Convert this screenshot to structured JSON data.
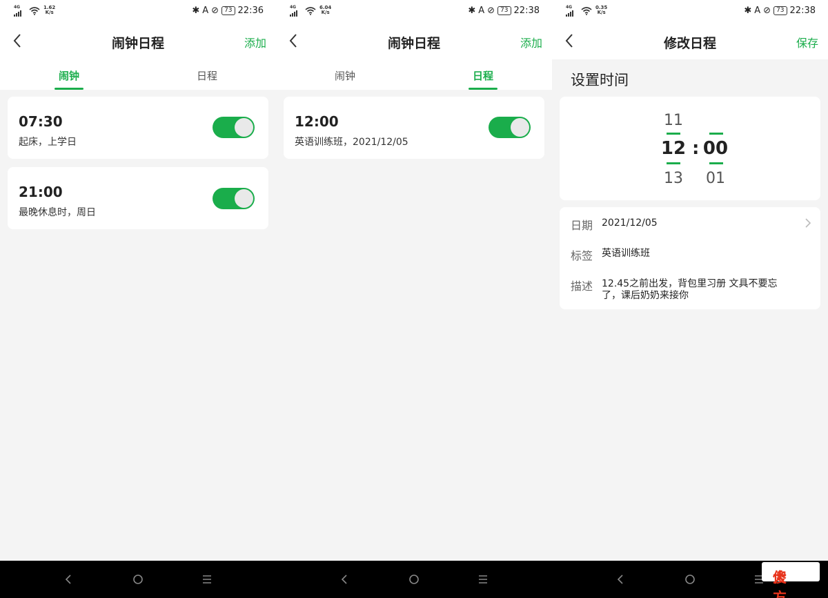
{
  "colors": {
    "accent": "#1aad4b",
    "background": "#f4f4f4",
    "card": "#ffffff"
  },
  "screen1": {
    "status": {
      "net": "4G",
      "speed_top": "1.62",
      "speed_unit": "K/s",
      "battery": "73",
      "clock": "22:36"
    },
    "header": {
      "title": "闹钟日程",
      "action": "添加"
    },
    "tabs": [
      {
        "label": "闹钟",
        "active": true
      },
      {
        "label": "日程",
        "active": false
      }
    ],
    "items": [
      {
        "time": "07:30",
        "desc": "起床，上学日",
        "enabled": true
      },
      {
        "time": "21:00",
        "desc": "最晚休息时，周日",
        "enabled": true
      }
    ]
  },
  "screen2": {
    "status": {
      "net": "4G",
      "speed_top": "6.04",
      "speed_unit": "K/s",
      "battery": "73",
      "clock": "22:38"
    },
    "header": {
      "title": "闹钟日程",
      "action": "添加"
    },
    "tabs": [
      {
        "label": "闹钟",
        "active": false
      },
      {
        "label": "日程",
        "active": true
      }
    ],
    "items": [
      {
        "time": "12:00",
        "desc": "英语训练班，2021/12/05",
        "enabled": true
      }
    ]
  },
  "screen3": {
    "status": {
      "net": "4G",
      "speed_top": "0.35",
      "speed_unit": "K/s",
      "battery": "73",
      "clock": "22:38"
    },
    "header": {
      "title": "修改日程",
      "action": "保存"
    },
    "section_title": "设置时间",
    "picker": {
      "hours": {
        "prev": "11",
        "selected": "12",
        "next": "13"
      },
      "separator": ":",
      "minutes": {
        "selected": "00",
        "next": "01"
      }
    },
    "form": {
      "date": {
        "label": "日期",
        "value": "2021/12/05"
      },
      "tag": {
        "label": "标签",
        "value": "英语训练班"
      },
      "description": {
        "label": "描述",
        "line1": "12.45之前出发，背包里习册 文具不要忘",
        "line2": "了，课后奶奶来接你"
      }
    }
  },
  "watermark": {
    "part1": "傻",
    "part2": "大方"
  }
}
